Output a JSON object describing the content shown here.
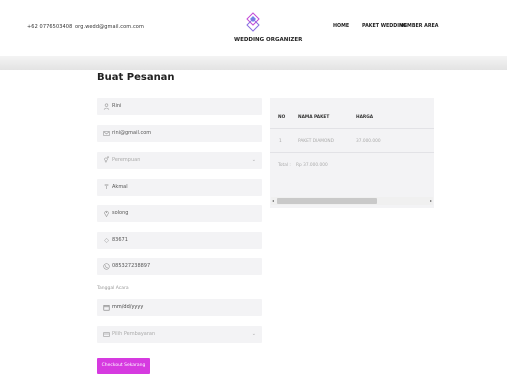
{
  "header": {
    "phone": "+62 0776503408",
    "email": "org.wedd@gmail.com.com",
    "brand": "WEDDING ORGANIZER",
    "nav": [
      "HOME",
      "PAKET WEDDING",
      "MEMBER AREA"
    ],
    "accent_color": "#d63ae0"
  },
  "page": {
    "title": "Buat Pesanan"
  },
  "form": {
    "name": "Rini",
    "email": "rini@gmail.com",
    "gender_placeholder": "Perempuan",
    "address": "Akmal",
    "city": "solong",
    "postal_code": "83671",
    "phone": "085327238897",
    "event_date_label": "Tanggal Acara",
    "event_date_placeholder": "mm/dd/yyyy",
    "payment_placeholder": "Pilih Pembayaran",
    "checkout_label": "Checkout Sekarang"
  },
  "order_table": {
    "headers": {
      "no": "NO",
      "package": "NAMA PAKET",
      "price": "HARGA"
    },
    "rows": [
      {
        "no": "1",
        "package": "PAKET DIAMOND",
        "price": "37.000.000"
      }
    ],
    "total_label": "Total :",
    "total_value": "Rp 37.000.000"
  },
  "icons": {
    "name": "user-icon",
    "email": "envelope-icon",
    "gender": "gender-icon",
    "address": "address-icon",
    "city": "location-icon",
    "postal": "postal-icon",
    "phone": "phone-icon",
    "date": "calendar-icon",
    "payment": "payment-icon"
  }
}
